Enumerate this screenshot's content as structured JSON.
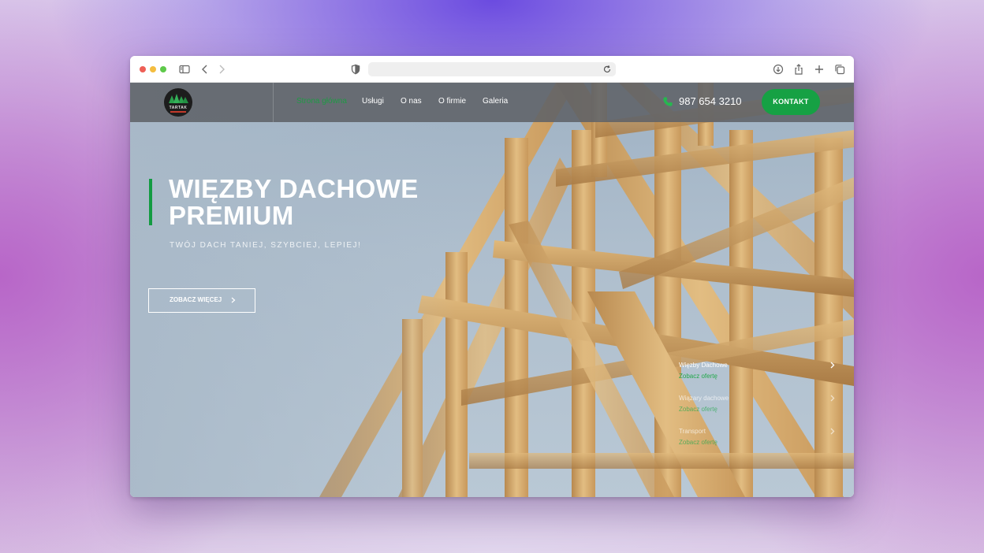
{
  "browser": {
    "icons": [
      "sidebar-icon",
      "back-icon",
      "forward-icon",
      "shield-icon",
      "reload-icon",
      "download-icon",
      "share-icon",
      "new-tab-icon",
      "tabs-overview-icon"
    ]
  },
  "site": {
    "logo_text": "TARTAK",
    "nav": [
      {
        "label": "Strona główna",
        "active": true
      },
      {
        "label": "Usługi",
        "active": false
      },
      {
        "label": "O nas",
        "active": false
      },
      {
        "label": "O firmie",
        "active": false
      },
      {
        "label": "Galeria",
        "active": false
      }
    ],
    "phone": "987 654 3210",
    "contact_button": "KONTAKT",
    "accent_color": "#16a144"
  },
  "hero": {
    "title_line1": "WIĘZBY DACHOWE",
    "title_line2": "PREMIUM",
    "subtitle": "TWÓJ DACH TANIEJ, SZYBCIEJ, LEPIEJ!",
    "button_label": "ZOBACZ WIĘCEJ"
  },
  "slides": [
    {
      "title": "Więzby Dachowe",
      "subtitle": "Zobacz ofertę"
    },
    {
      "title": "Wiązary dachowe",
      "subtitle": "Zobacz ofertę"
    },
    {
      "title": "Transport",
      "subtitle": "Zobacz ofertę"
    }
  ]
}
